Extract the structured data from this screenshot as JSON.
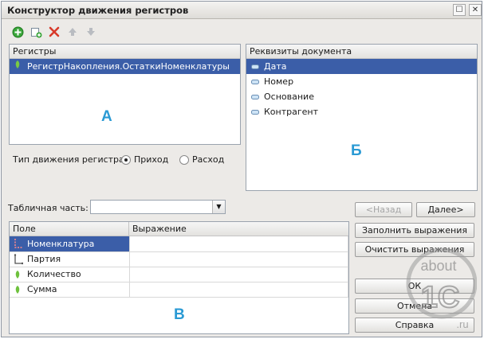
{
  "window": {
    "title": "Конструктор движения регистров"
  },
  "titlebar": {
    "maximize_glyph": "☐",
    "close_glyph": "✕"
  },
  "toolbar": {
    "add_icon": "add-green-icon",
    "copy_icon": "copy-add-icon",
    "delete_icon": "delete-red-icon",
    "up_icon": "arrow-up-icon",
    "down_icon": "arrow-down-icon"
  },
  "registers": {
    "header": "Регистры",
    "items": [
      {
        "label": "РегистрНакопления.ОстаткиНоменклатуры"
      }
    ]
  },
  "requisites": {
    "header": "Реквизиты документа",
    "items": [
      {
        "label": "Дата"
      },
      {
        "label": "Номер"
      },
      {
        "label": "Основание"
      },
      {
        "label": "Контрагент"
      }
    ]
  },
  "movement_type": {
    "label": "Тип движения регистра:",
    "options": [
      {
        "label": "Приход",
        "selected": true
      },
      {
        "label": "Расход",
        "selected": false
      }
    ]
  },
  "tabular_part": {
    "label": "Табличная часть:",
    "value": ""
  },
  "nav": {
    "back": "<Назад",
    "next": "Далее>"
  },
  "fields_table": {
    "col_field": "Поле",
    "col_expression": "Выражение",
    "rows": [
      {
        "field": "Номенклатура",
        "expression": ""
      },
      {
        "field": "Партия",
        "expression": ""
      },
      {
        "field": "Количество",
        "expression": ""
      },
      {
        "field": "Сумма",
        "expression": ""
      }
    ]
  },
  "actions": {
    "fill": "Заполнить выражения",
    "clear": "Очистить выражения",
    "ok": "ОК",
    "cancel": "Отмена",
    "help": "Справка"
  },
  "annotations": {
    "a": "А",
    "b": "Б",
    "c": "В"
  },
  "watermark": {
    "line1": "about",
    "line2": "1C",
    "line3": ".ru"
  },
  "colors": {
    "selection": "#3b5ea8",
    "annotation": "#2a9ad4",
    "add": "#3aa63a",
    "delete": "#d83a2a"
  }
}
